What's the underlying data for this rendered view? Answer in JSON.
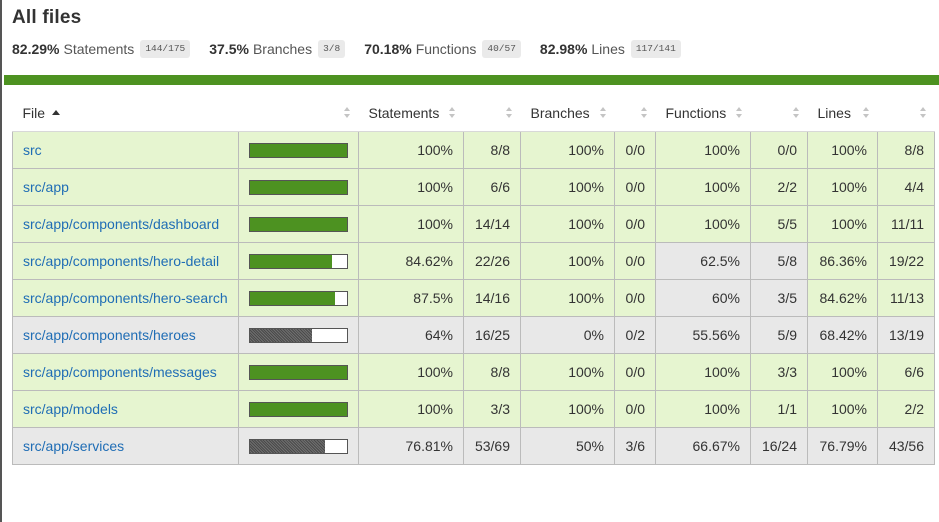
{
  "title": "All files",
  "summary": [
    {
      "pct": "82.29%",
      "label": "Statements",
      "fraction": "144/175"
    },
    {
      "pct": "37.5%",
      "label": "Branches",
      "fraction": "3/8"
    },
    {
      "pct": "70.18%",
      "label": "Functions",
      "fraction": "40/57"
    },
    {
      "pct": "82.98%",
      "label": "Lines",
      "fraction": "117/141"
    }
  ],
  "colors": {
    "high_bg": "#e6f5d0",
    "medium_bg": "#e8e8e8",
    "bar_high": "#4d9221",
    "link": "#1f6db5"
  },
  "table": {
    "headers": {
      "file": "File",
      "statements": "Statements",
      "branches": "Branches",
      "functions": "Functions",
      "lines": "Lines"
    },
    "rows": [
      {
        "file": "src",
        "coverage": 1.0,
        "level": "high",
        "cells": [
          "100%",
          "8/8",
          "100%",
          "0/0",
          "100%",
          "0/0",
          "100%",
          "8/8"
        ],
        "levels": [
          "high",
          "high",
          "high",
          "high"
        ]
      },
      {
        "file": "src/app",
        "coverage": 1.0,
        "level": "high",
        "cells": [
          "100%",
          "6/6",
          "100%",
          "0/0",
          "100%",
          "2/2",
          "100%",
          "4/4"
        ],
        "levels": [
          "high",
          "high",
          "high",
          "high"
        ]
      },
      {
        "file": "src/app/components/dashboard",
        "coverage": 1.0,
        "level": "high",
        "cells": [
          "100%",
          "14/14",
          "100%",
          "0/0",
          "100%",
          "5/5",
          "100%",
          "11/11"
        ],
        "levels": [
          "high",
          "high",
          "high",
          "high"
        ]
      },
      {
        "file": "src/app/components/hero-detail",
        "coverage": 0.8462,
        "level": "high",
        "cells": [
          "84.62%",
          "22/26",
          "100%",
          "0/0",
          "62.5%",
          "5/8",
          "86.36%",
          "19/22"
        ],
        "levels": [
          "high",
          "high",
          "medium",
          "high"
        ]
      },
      {
        "file": "src/app/components/hero-search",
        "coverage": 0.875,
        "level": "high",
        "cells": [
          "87.5%",
          "14/16",
          "100%",
          "0/0",
          "60%",
          "3/5",
          "84.62%",
          "11/13"
        ],
        "levels": [
          "high",
          "high",
          "medium",
          "high"
        ]
      },
      {
        "file": "src/app/components/heroes",
        "coverage": 0.64,
        "level": "medium",
        "cells": [
          "64%",
          "16/25",
          "0%",
          "0/2",
          "55.56%",
          "5/9",
          "68.42%",
          "13/19"
        ],
        "levels": [
          "medium",
          "medium",
          "medium",
          "medium"
        ]
      },
      {
        "file": "src/app/components/messages",
        "coverage": 1.0,
        "level": "high",
        "cells": [
          "100%",
          "8/8",
          "100%",
          "0/0",
          "100%",
          "3/3",
          "100%",
          "6/6"
        ],
        "levels": [
          "high",
          "high",
          "high",
          "high"
        ]
      },
      {
        "file": "src/app/models",
        "coverage": 1.0,
        "level": "high",
        "cells": [
          "100%",
          "3/3",
          "100%",
          "0/0",
          "100%",
          "1/1",
          "100%",
          "2/2"
        ],
        "levels": [
          "high",
          "high",
          "high",
          "high"
        ]
      },
      {
        "file": "src/app/services",
        "coverage": 0.7681,
        "level": "medium",
        "cells": [
          "76.81%",
          "53/69",
          "50%",
          "3/6",
          "66.67%",
          "16/24",
          "76.79%",
          "43/56"
        ],
        "levels": [
          "medium",
          "medium",
          "medium",
          "medium"
        ]
      }
    ]
  }
}
